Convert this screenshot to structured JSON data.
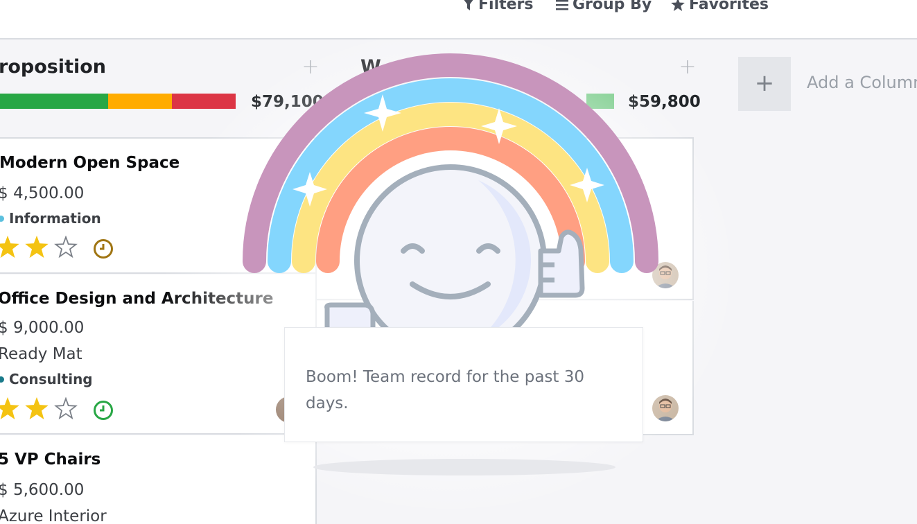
{
  "control_panel": {
    "filters_label": "Filters",
    "group_by_label": "Group By",
    "favorites_label": "Favorites"
  },
  "columns": [
    {
      "title": "roposition",
      "total": "$79,100",
      "progress": [
        {
          "status": "on-track",
          "color": "#28a745",
          "fraction": 0.46
        },
        {
          "status": "warning",
          "color": "#ffac00",
          "fraction": 0.27
        },
        {
          "status": "overdue",
          "color": "#dc3545",
          "fraction": 0.27
        }
      ],
      "cards": [
        {
          "name": "Modern Open Space",
          "amount": "$ 4,500.00",
          "company": "",
          "tag": "Information",
          "tag_color": "#5bc0de",
          "stars": 2,
          "activity_color": "#a07513"
        },
        {
          "name": "Office Design and Architecture",
          "amount": "$ 9,000.00",
          "company": "Ready Mat",
          "tag": "Consulting",
          "tag_color": "#1a7a8a",
          "stars": 2,
          "activity_color": "#28a745"
        },
        {
          "name": "5 VP Chairs",
          "amount": "$ 5,600.00",
          "company": "Azure Interior"
        }
      ]
    },
    {
      "title": "W",
      "total": "$59,800",
      "progress": [
        {
          "status": "on-track",
          "color": "#7dcd8d",
          "fraction": 1.0
        }
      ]
    }
  ],
  "add_column": {
    "button_glyph": "+",
    "label": "Add a Column"
  },
  "rainbow_man": {
    "message": "Boom! Team record for the past 30 days."
  },
  "colors": {
    "rainbow_outer": "#c895bc",
    "rainbow_blue": "#84d6fd",
    "rainbow_yellow": "#fde482",
    "rainbow_salmon": "#ff9f82",
    "face_outline": "#a4afbb",
    "star_gold": "#f4c312"
  }
}
